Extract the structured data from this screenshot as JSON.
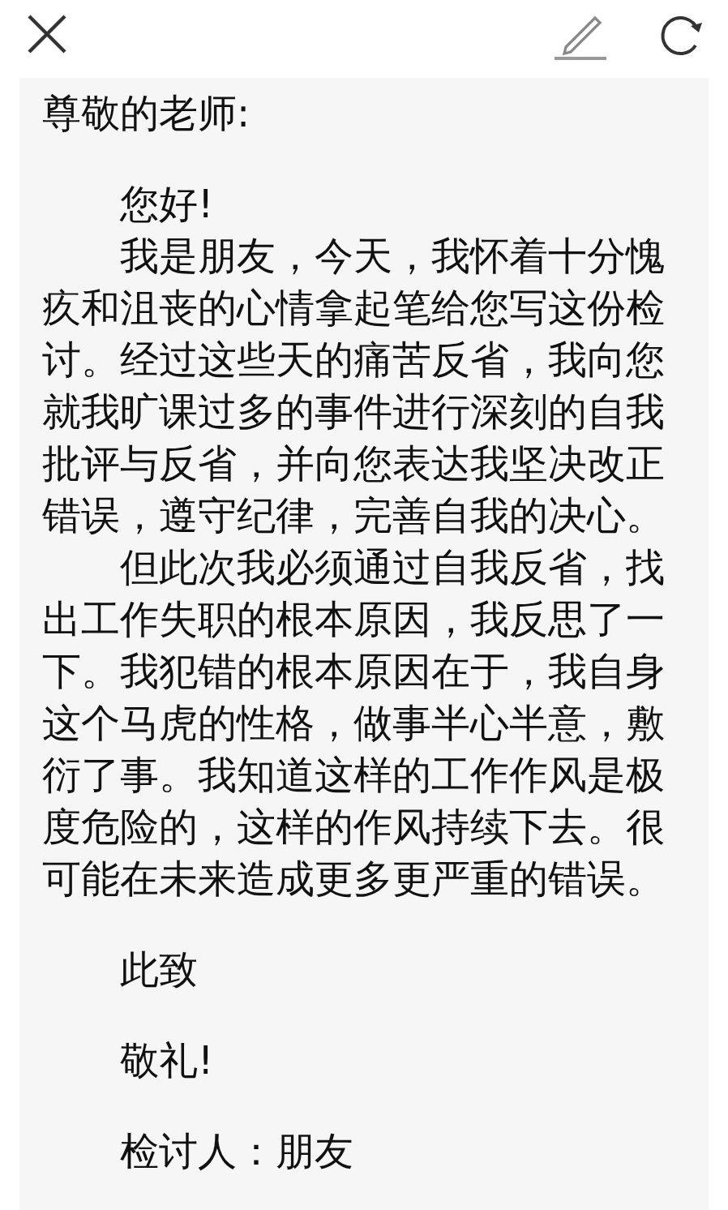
{
  "letter": {
    "salutation": "尊敬的老师:",
    "greeting": "您好!",
    "paragraphs": [
      "我是朋友，今天，我怀着十分愧疚和沮丧的心情拿起笔给您写这份检讨。经过这些天的痛苦反省，我向您就我旷课过多的事件进行深刻的自我批评与反省，并向您表达我坚决改正错误，遵守纪律，完善自我的决心。",
      "但此次我必须通过自我反省，找出工作失职的根本原因，我反思了一下。我犯错的根本原因在于，我自身这个马虎的性格，做事半心半意，敷衍了事。我知道这样的工作作风是极度危险的，这样的作风持续下去。很可能在未来造成更多更严重的错误。"
    ],
    "closing": "此致",
    "regards": "敬礼!",
    "signature": "检讨人：朋友"
  }
}
